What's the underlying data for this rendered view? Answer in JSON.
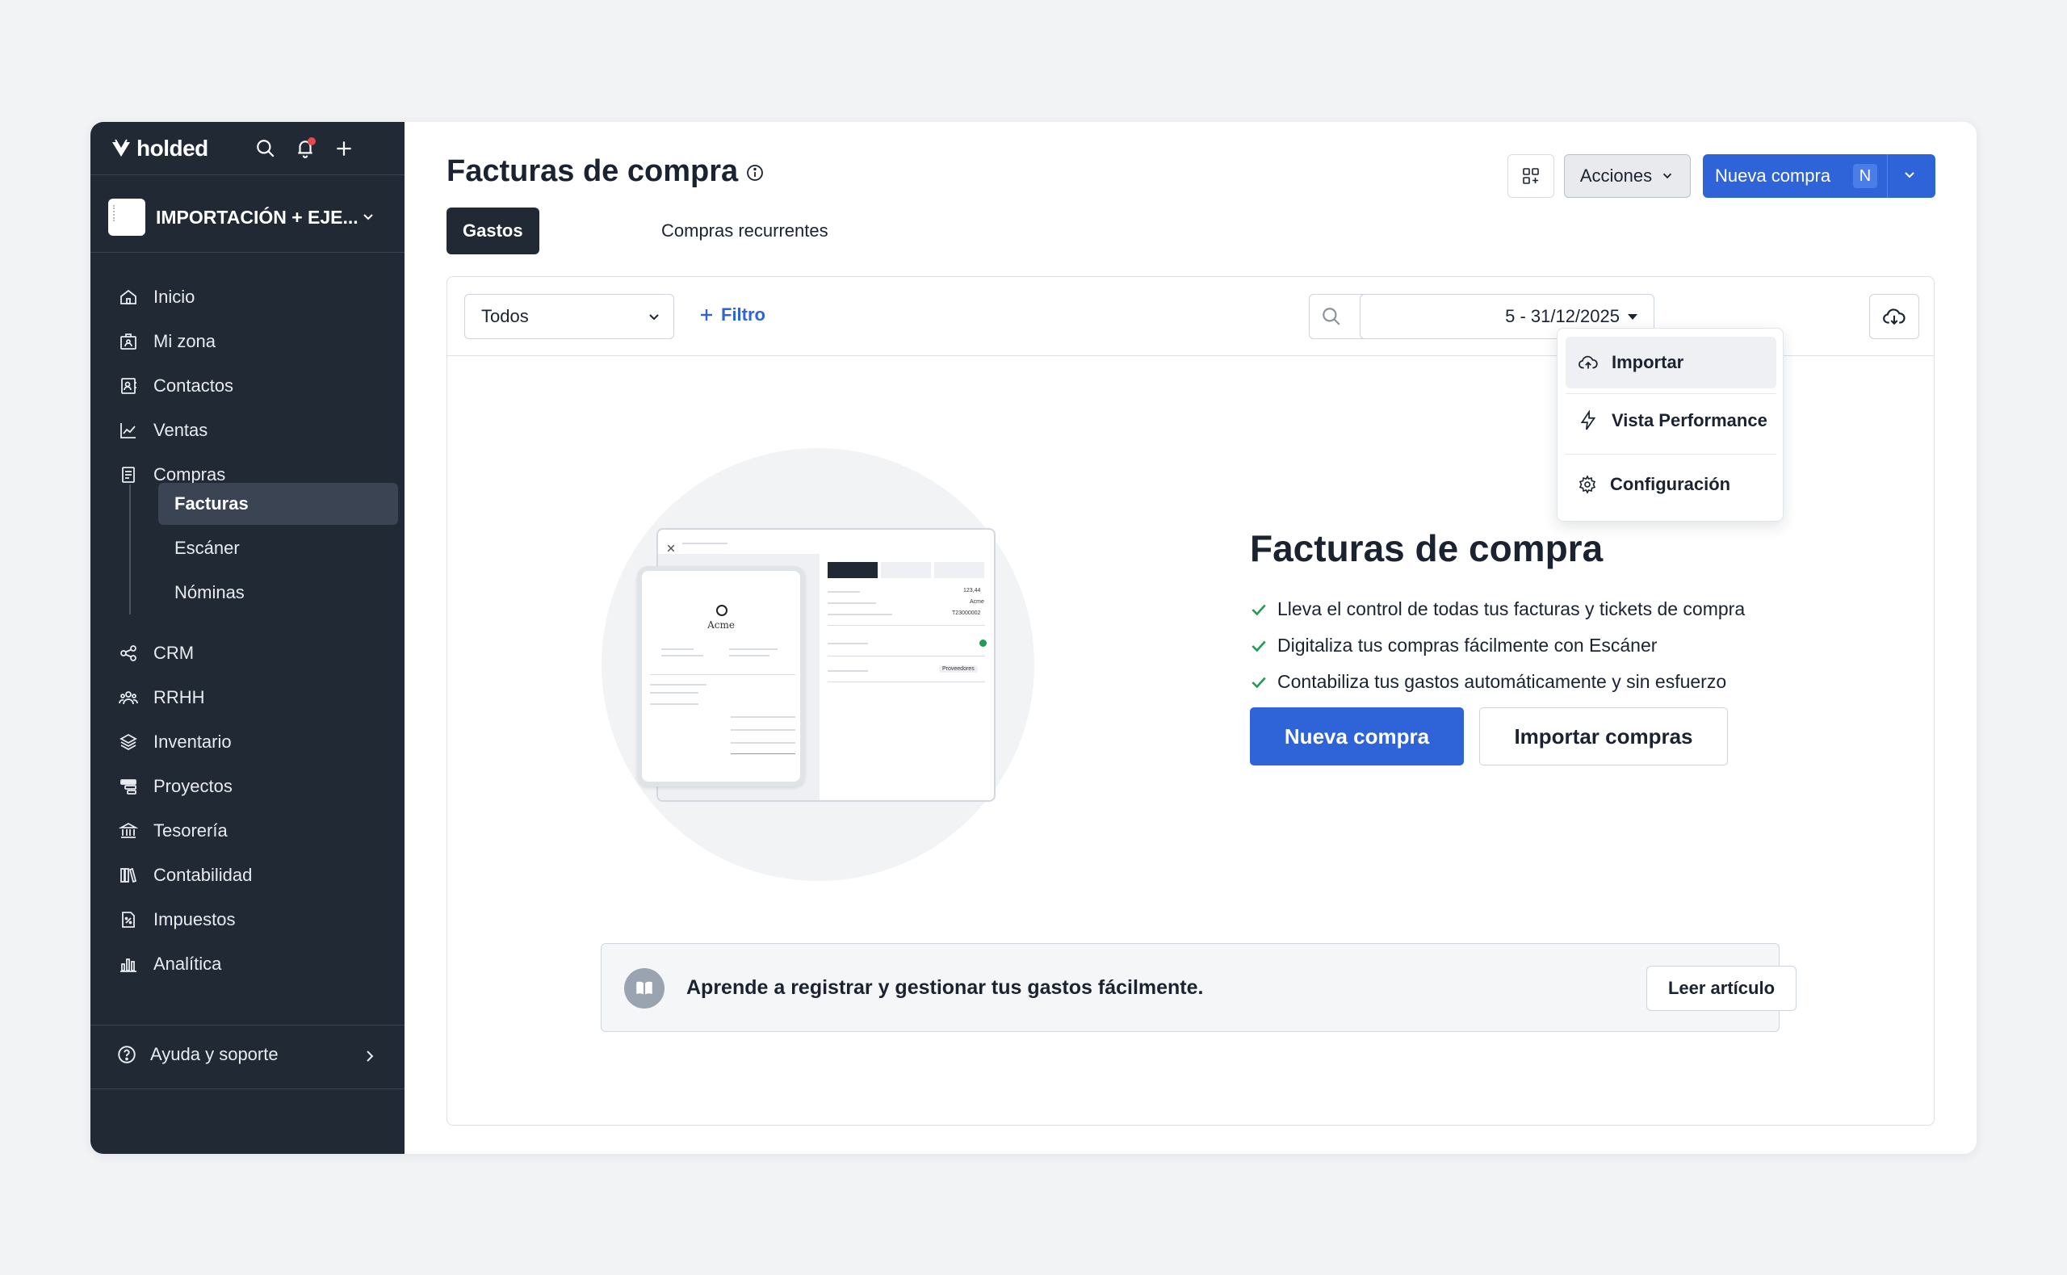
{
  "brand": {
    "name": "holded"
  },
  "company": {
    "name": "IMPORTACIÓN + EJE..."
  },
  "sidebar": {
    "items": [
      {
        "label": "Inicio",
        "icon": "home-icon"
      },
      {
        "label": "Mi zona",
        "icon": "id-badge-icon"
      },
      {
        "label": "Contactos",
        "icon": "contacts-icon"
      },
      {
        "label": "Ventas",
        "icon": "chart-line-icon"
      },
      {
        "label": "Compras",
        "icon": "receipt-icon"
      }
    ],
    "sub_items": [
      {
        "label": "Facturas",
        "active": true
      },
      {
        "label": "Escáner",
        "active": false
      },
      {
        "label": "Nóminas",
        "active": false
      }
    ],
    "items_after": [
      {
        "label": "CRM",
        "icon": "share-icon"
      },
      {
        "label": "RRHH",
        "icon": "people-icon"
      },
      {
        "label": "Inventario",
        "icon": "layers-icon"
      },
      {
        "label": "Proyectos",
        "icon": "projects-icon"
      },
      {
        "label": "Tesorería",
        "icon": "bank-icon"
      },
      {
        "label": "Contabilidad",
        "icon": "books-icon"
      },
      {
        "label": "Impuestos",
        "icon": "tax-document-icon"
      },
      {
        "label": "Analítica",
        "icon": "bar-chart-icon"
      }
    ],
    "help_label": "Ayuda y soporte"
  },
  "header": {
    "title": "Facturas de compra",
    "acciones_label": "Acciones",
    "nueva_compra_label": "Nueva compra",
    "nueva_compra_shortcut": "N"
  },
  "tabs": [
    {
      "label": "Gastos",
      "active": true
    },
    {
      "label": "Compras recurrentes",
      "active": false
    }
  ],
  "filters": {
    "select_value": "Todos",
    "filtro_label": "Filtro",
    "date_range": "5 - 31/12/2025"
  },
  "menu": {
    "items": [
      {
        "label": "Importar",
        "icon": "cloud-upload-icon"
      },
      {
        "label": "Vista Performance",
        "icon": "bolt-icon"
      },
      {
        "label": "Configuración",
        "icon": "gear-icon"
      }
    ]
  },
  "empty_state": {
    "title": "Facturas de compra",
    "features": [
      "Lleva el control de todas tus facturas y tickets de compra",
      "Digitaliza tus compras fácilmente con Escáner",
      "Contabiliza tus gastos automáticamente y sin esfuerzo"
    ],
    "primary_button": "Nueva compra",
    "secondary_button": "Importar compras",
    "illustration_brand": "Acme",
    "illustration_badge": "Proveedores",
    "illustration_amount": "123,44",
    "illustration_ref": "T23000002"
  },
  "learn": {
    "text": "Aprende a registrar y gestionar tus gastos fácilmente.",
    "button": "Leer artículo"
  },
  "colors": {
    "sidebar_bg": "#212935",
    "primary": "#2f63d8",
    "check": "#1f9d55",
    "notification": "#e5484d"
  }
}
